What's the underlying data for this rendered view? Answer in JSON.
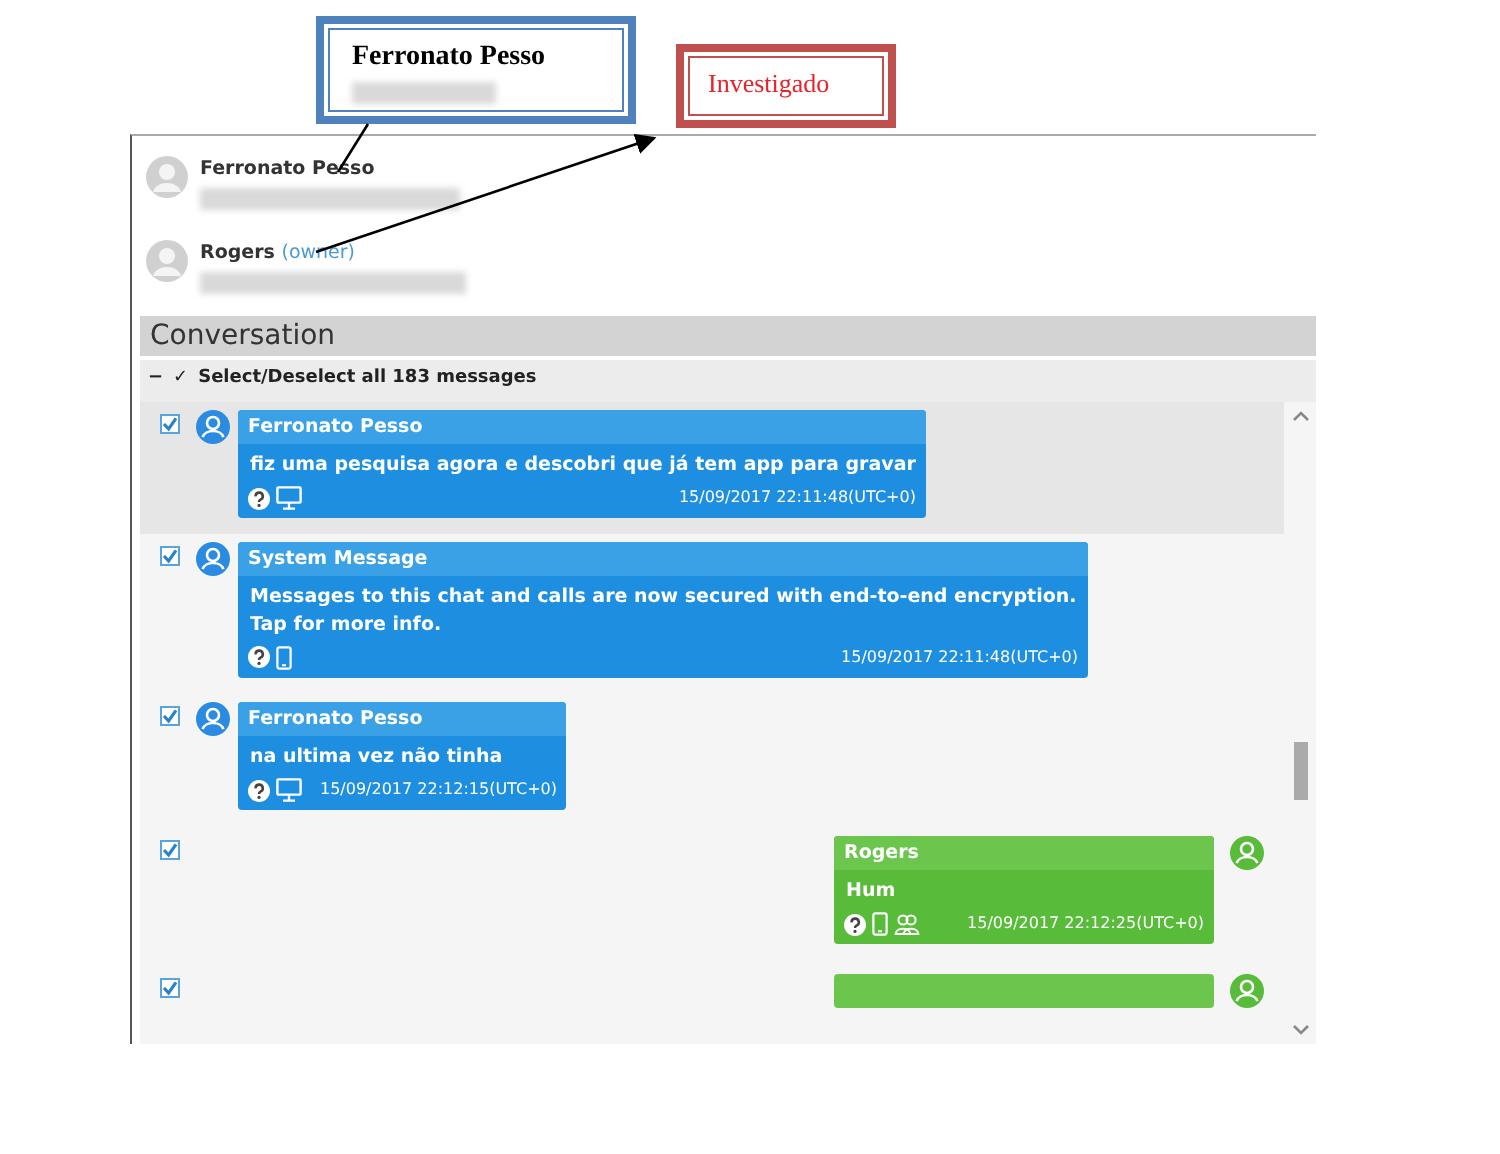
{
  "callouts": [
    {
      "kind": "contact",
      "title": "Ferronato Pesso",
      "redacted": true
    },
    {
      "kind": "label",
      "title": "Investigado"
    }
  ],
  "participants": [
    {
      "name": "Ferronato Pesso"
    },
    {
      "name": "Rogers",
      "role": "(owner)"
    }
  ],
  "conversation": {
    "title": "Conversation",
    "collapse": "−",
    "check": "✓",
    "select_all": "Select/Deselect all 183 messages"
  },
  "messages": [
    {
      "kind": "incoming",
      "sender": "Ferronato Pesso",
      "text": "fiz uma pesquisa agora e descobri que já tem app para gravar",
      "time": "15/09/2017 22:11:48(UTC+0)",
      "mobile": false,
      "group": false,
      "checked": true,
      "selected": true
    },
    {
      "kind": "incoming",
      "sender": "System Message",
      "text": "Messages to this chat and calls are now secured with end-to-end encryption. Tap for more info.",
      "time": "15/09/2017 22:11:48(UTC+0)",
      "mobile": true,
      "group": false,
      "checked": true,
      "selected": false
    },
    {
      "kind": "incoming",
      "sender": "Ferronato Pesso",
      "text": "na ultima vez não tinha",
      "time": "15/09/2017 22:12:15(UTC+0)",
      "mobile": false,
      "group": false,
      "checked": true,
      "selected": false
    },
    {
      "kind": "outgoing",
      "sender": "Rogers",
      "text": "Hum",
      "time": "15/09/2017 22:12:25(UTC+0)",
      "mobile": true,
      "group": true,
      "checked": true,
      "selected": false
    },
    {
      "kind": "outgoing",
      "checked": true,
      "selected": false
    }
  ]
}
